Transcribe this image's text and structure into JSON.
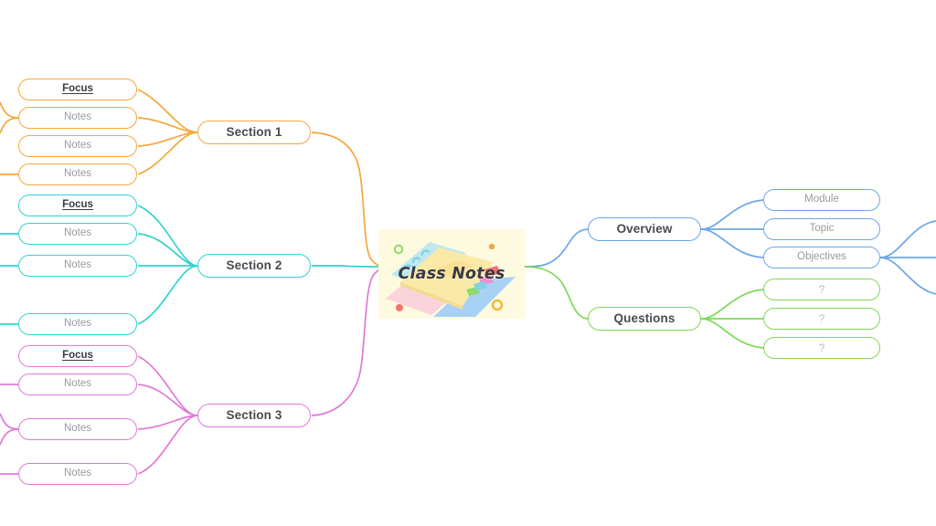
{
  "center": {
    "title": "Class Notes",
    "image_name": "notebook-illustration",
    "background": "#fdfae0"
  },
  "colors": {
    "orange": "#f5a73c",
    "cyan": "#2fd4cf",
    "magenta": "#e07ad6",
    "blue": "#6ba6e8",
    "green": "#7ed957",
    "node_fill": "#ffffff",
    "branch_text": "#4a4a52",
    "leaf_text": "#9a9aa2"
  },
  "branches": [
    {
      "id": "section-1",
      "label": "Section 1",
      "color": "#f5a73c",
      "side": "left",
      "children": [
        {
          "label": "Focus",
          "style": "focus"
        },
        {
          "label": "Notes",
          "style": "plain"
        },
        {
          "label": "Notes",
          "style": "plain"
        },
        {
          "label": "Notes",
          "style": "plain"
        }
      ]
    },
    {
      "id": "section-2",
      "label": "Section 2",
      "color": "#2fd4cf",
      "side": "left",
      "children": [
        {
          "label": "Focus",
          "style": "focus"
        },
        {
          "label": "Notes",
          "style": "plain"
        },
        {
          "label": "Notes",
          "style": "plain"
        },
        {
          "label": "Notes",
          "style": "plain"
        }
      ]
    },
    {
      "id": "section-3",
      "label": "Section 3",
      "color": "#e07ad6",
      "side": "left",
      "children": [
        {
          "label": "Focus",
          "style": "focus"
        },
        {
          "label": "Notes",
          "style": "plain"
        },
        {
          "label": "Notes",
          "style": "plain"
        },
        {
          "label": "Notes",
          "style": "plain"
        }
      ]
    },
    {
      "id": "overview",
      "label": "Overview",
      "color": "#6ba6e8",
      "side": "right",
      "children": [
        {
          "label": "Module",
          "style": "plain"
        },
        {
          "label": "Topic",
          "style": "plain"
        },
        {
          "label": "Objectives",
          "style": "plain"
        }
      ]
    },
    {
      "id": "questions",
      "label": "Questions",
      "color": "#7ed957",
      "side": "right",
      "children": [
        {
          "label": "?",
          "style": "qmark"
        },
        {
          "label": "?",
          "style": "qmark"
        },
        {
          "label": "?",
          "style": "qmark"
        }
      ]
    }
  ]
}
